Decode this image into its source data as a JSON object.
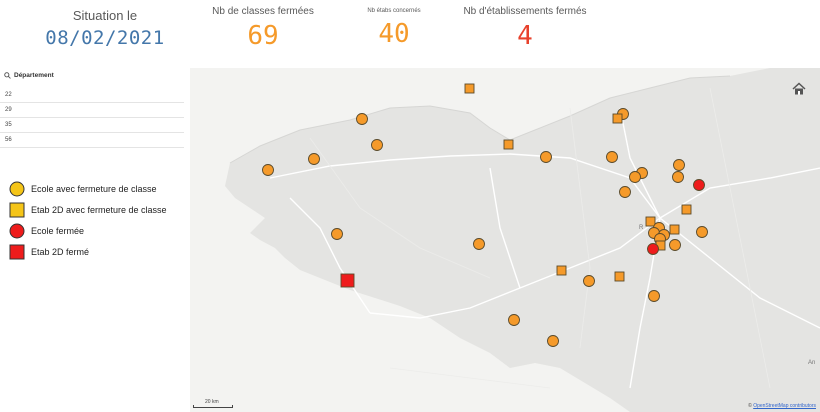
{
  "header": {
    "date_label": "Situation le",
    "date_value": "08/02/2021"
  },
  "kpis": [
    {
      "label": "Nb de classes fermées",
      "value": "69",
      "color": "#f59a2a"
    },
    {
      "label": "Nb étabs concernés",
      "value": "40",
      "color": "#f59a2a"
    },
    {
      "label": "Nb d'établissements fermés",
      "value": "4",
      "color": "#e8412c"
    }
  ],
  "filter": {
    "title": "Département",
    "icon": "search-icon",
    "items": [
      "22",
      "29",
      "35",
      "56"
    ]
  },
  "legend": {
    "items": [
      {
        "label": "Ecole avec fermeture de classe",
        "shape": "circle",
        "color": "#f5c518"
      },
      {
        "label": "Etab 2D avec fermeture de classe",
        "shape": "square",
        "color": "#f5c518"
      },
      {
        "label": "Ecole fermée",
        "shape": "circle",
        "color": "#ee1c1c"
      },
      {
        "label": "Etab 2D fermé",
        "shape": "square",
        "color": "#ee1c1c"
      }
    ]
  },
  "map": {
    "scale_label": "20 km",
    "attribution_prefix": "© ",
    "attribution_link": "OpenStreetMap contributors",
    "place_label_1": "R",
    "place_label_2": "An",
    "home_icon": "home-icon",
    "marker_colors": {
      "open": "#f59a2a",
      "closed": "#ee1c1c",
      "stroke": "#5a4a2a"
    }
  }
}
